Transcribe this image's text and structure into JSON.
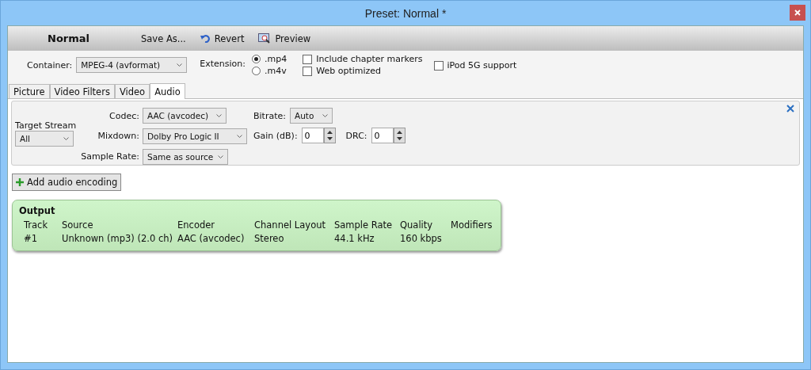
{
  "window": {
    "title": "Preset: Normal *"
  },
  "toolbar": {
    "preset_name": "Normal",
    "buttons": [
      {
        "kind": "plain",
        "label": "Save As..."
      },
      {
        "kind": "revert",
        "label": "Revert"
      },
      {
        "kind": "preview",
        "label": "Preview"
      }
    ]
  },
  "container": {
    "label": "Container:",
    "value": "MPEG-4 (avformat)"
  },
  "extension": {
    "label": "Extension:",
    "options": [
      {
        "label": ".mp4",
        "selected": true
      },
      {
        "label": ".m4v",
        "selected": false
      }
    ]
  },
  "options": [
    {
      "label": "Include chapter markers",
      "checked": false
    },
    {
      "label": "Web optimized",
      "checked": false
    },
    {
      "label": "iPod 5G support",
      "checked": false
    }
  ],
  "tabs": [
    {
      "label": "Picture",
      "selected": false
    },
    {
      "label": "Video Filters",
      "selected": false
    },
    {
      "label": "Video",
      "selected": false
    },
    {
      "label": "Audio",
      "selected": true
    }
  ],
  "audio": {
    "target_stream": {
      "label": "Target Stream",
      "value": "All"
    },
    "codec": {
      "label": "Codec:",
      "value": "AAC (avcodec)"
    },
    "mixdown": {
      "label": "Mixdown:",
      "value": "Dolby Pro Logic II"
    },
    "sample_rate": {
      "label": "Sample Rate:",
      "value": "Same as source"
    },
    "bitrate": {
      "label": "Bitrate:",
      "value": "Auto"
    },
    "gain": {
      "label": "Gain (dB):",
      "value": "0"
    },
    "drc": {
      "label": "DRC:",
      "value": "0"
    }
  },
  "add_button": "Add audio encoding",
  "output": {
    "title": "Output",
    "columns": [
      "Track",
      "Source",
      "Encoder",
      "Channel Layout",
      "Sample Rate",
      "Quality",
      "Modifiers"
    ],
    "rows": [
      [
        "#1",
        "Unknown (mp3) (2.0 ch)",
        "AAC (avcodec)",
        "Stereo",
        "44.1 kHz",
        "160 kbps",
        ""
      ]
    ]
  }
}
